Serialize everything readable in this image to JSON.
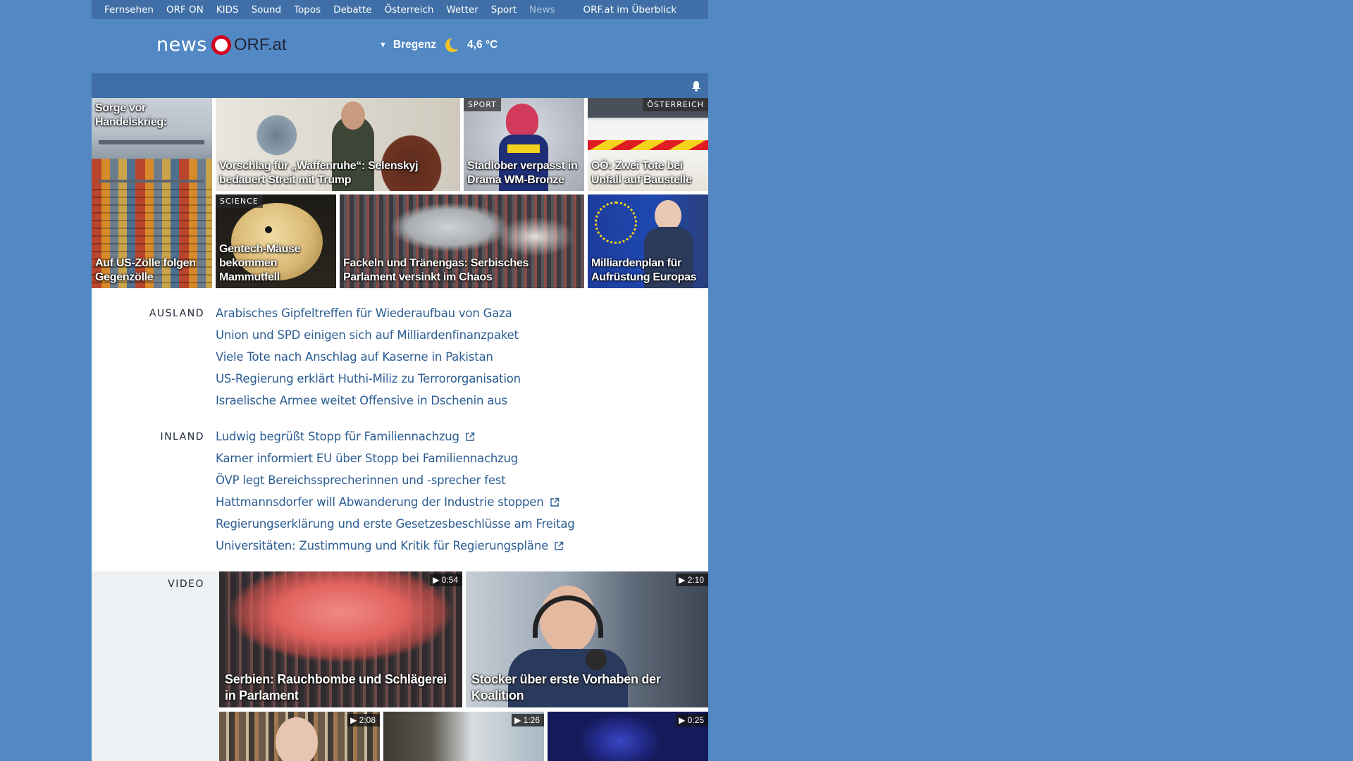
{
  "nav": {
    "items": [
      "Fernsehen",
      "ORF ON",
      "KIDS",
      "Sound",
      "Topos",
      "Debatte",
      "Österreich",
      "Wetter",
      "Sport",
      "News"
    ],
    "active": "News",
    "overview": "ORF.at im Überblick"
  },
  "brand": {
    "news": "news",
    "orf": "ORF.at"
  },
  "weather": {
    "city": "Bregenz",
    "temperature": "4,6 °C",
    "icon": "moon-icon"
  },
  "tiles": {
    "handelskrieg_top": "Sorge vor Handelskrieg:",
    "handelskrieg_bottom": "Auf US-Zölle folgen Gegenzölle",
    "selenskyj": "Vorschlag für „Waffenruhe“: Selenskyj bedauert Streit mit Trump",
    "sport_tag": "SPORT",
    "sport": "Stadlober verpasst in Drama WM-Bronze",
    "oesterreich_tag": "ÖSTERREICH",
    "oesterreich": "OÖ: Zwei Tote bei Unfall auf Baustelle",
    "science_tag": "SCIENCE",
    "science": "Gentech-Mäuse bekommen Mammutfell",
    "serbien": "Fackeln und Tränengas: Serbisches Parlament versinkt im Chaos",
    "europa": "Milliardenplan für Aufrüstung Europas"
  },
  "ausland": {
    "label": "AUSLAND",
    "items": [
      "Arabisches Gipfeltreffen für Wiederaufbau von Gaza",
      "Union und SPD einigen sich auf Milliardenfinanzpaket",
      "Viele Tote nach Anschlag auf Kaserne in Pakistan",
      "US-Regierung erklärt Huthi-Miliz zu Terrororganisation",
      "Israelische Armee weitet Offensive in Dschenin aus"
    ]
  },
  "inland": {
    "label": "INLAND",
    "items": [
      "Ludwig begrüßt Stopp für Familiennachzug",
      "Karner informiert EU über Stopp bei Familiennachzug",
      "ÖVP legt Bereichssprecherinnen und -sprecher fest",
      "Hattmannsdorfer will Abwanderung der Industrie stoppen",
      "Regierungserklärung und erste Gesetzesbeschlüsse am Freitag",
      "Universitäten: Zustimmung und Kritik für Regierungspläne"
    ],
    "external": [
      true,
      false,
      false,
      true,
      false,
      true
    ]
  },
  "video": {
    "label": "VIDEO",
    "main": [
      {
        "title": "Serbien: Rauchbombe und Schlägerei in Parlament",
        "duration": "0:54"
      },
      {
        "title": "Stocker über erste Vorhaben der Koalition",
        "duration": "2:10"
      }
    ],
    "small": [
      {
        "duration": "2:08"
      },
      {
        "duration": "1:26"
      },
      {
        "duration": "0:25"
      }
    ]
  },
  "colors": {
    "background": "#5289c4",
    "nav_bar": "#3f6fa6",
    "link": "#2b5d93",
    "brand_red": "#d6001c"
  }
}
